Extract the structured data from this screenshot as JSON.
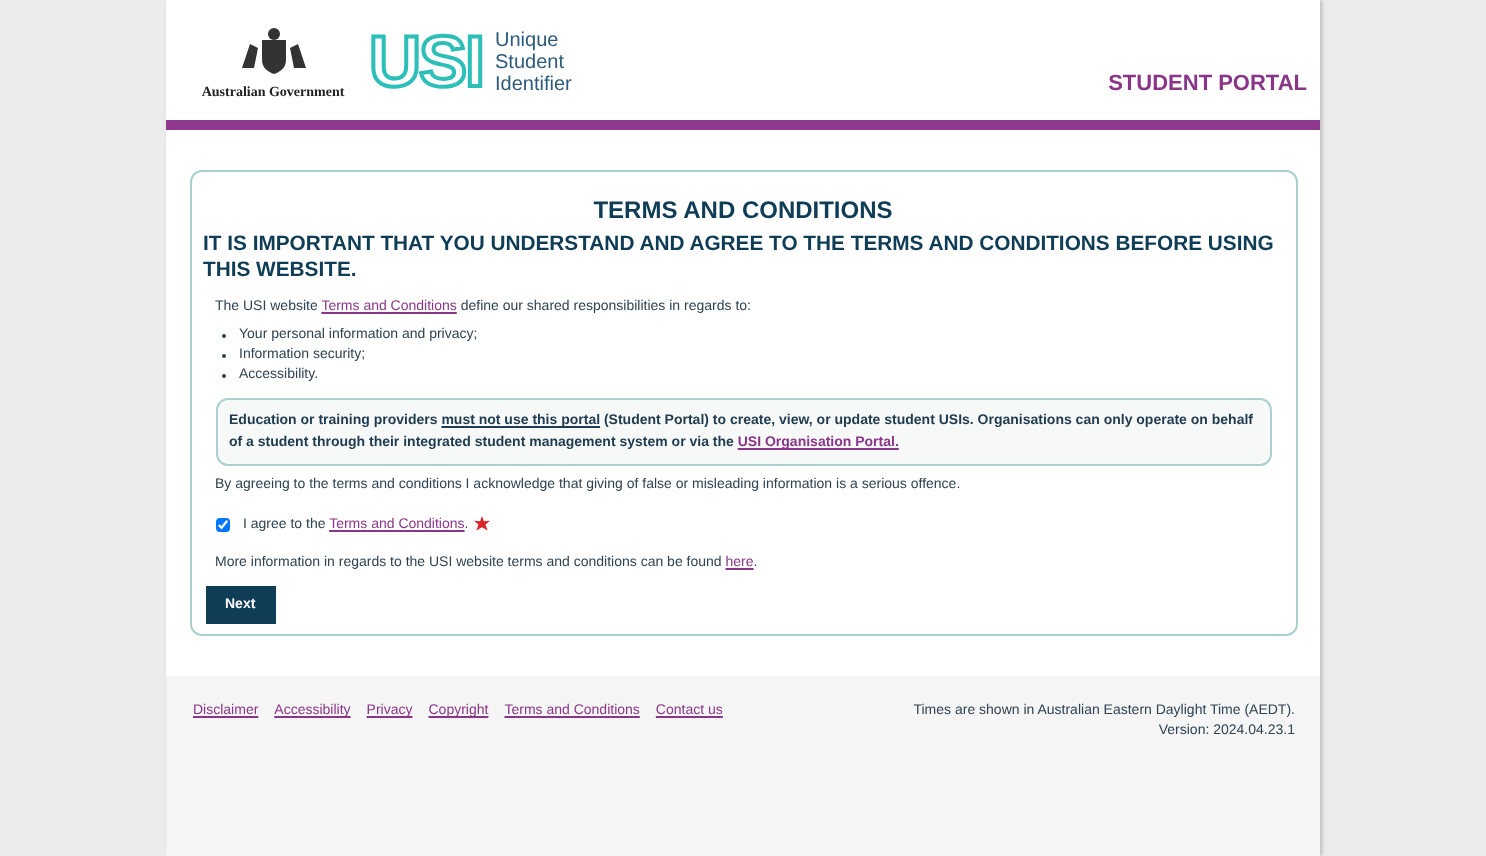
{
  "header": {
    "gov_name": "Australian Government",
    "usi_mark": "USI",
    "usi_words": [
      "Unique",
      "Student",
      "Identifier"
    ],
    "portal_title": "STUDENT PORTAL"
  },
  "card": {
    "title": "TERMS AND CONDITIONS",
    "subtitle": "IT IS IMPORTANT THAT YOU UNDERSTAND AND AGREE TO THE TERMS AND CONDITIONS BEFORE USING THIS WEBSITE.",
    "intro": {
      "before": "The USI website ",
      "link": "Terms and Conditions",
      "after": " define our shared responsibilities in regards to:"
    },
    "bullets": [
      "Your personal information and privacy;",
      "Information security;",
      "Accessibility."
    ],
    "notice": {
      "before": "Education or training providers ",
      "underlined": "must not use this portal",
      "middle": " (Student Portal) to create, view, or update student USIs. Organisations can only operate on behalf of a student through their integrated student management system or via the ",
      "link": "USI Organisation Portal."
    },
    "acknowledge": "By agreeing to the terms and conditions I acknowledge that giving of false or misleading information is a serious offence.",
    "agree": {
      "checked": true,
      "before": "I agree to the ",
      "link": "Terms and Conditions",
      "after": ".",
      "required": true
    },
    "more_info": {
      "before": "More information in regards to the USI website terms and conditions can be found ",
      "link": "here",
      "after": "."
    },
    "button": "Next"
  },
  "footer": {
    "links": [
      "Disclaimer",
      "Accessibility",
      "Privacy",
      "Copyright",
      "Terms and Conditions",
      "Contact us"
    ],
    "timezone": "Times are shown in Australian Eastern Daylight Time (AEDT).",
    "version": "Version: 2024.04.23.1"
  }
}
